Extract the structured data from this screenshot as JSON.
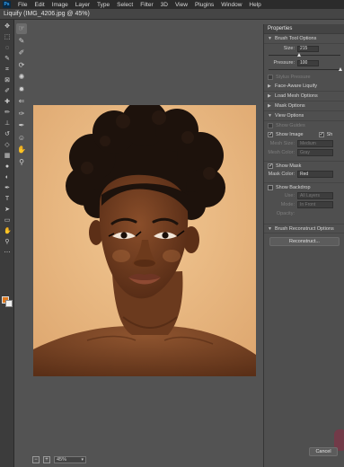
{
  "app": {
    "logo": "Ps"
  },
  "menu": [
    "File",
    "Edit",
    "Image",
    "Layer",
    "Type",
    "Select",
    "Filter",
    "3D",
    "View",
    "Plugins",
    "Window",
    "Help"
  ],
  "dialog": {
    "title": "Liquify (IMG_4206.jpg @ 45%)"
  },
  "canvas": {
    "zoom": "45%"
  },
  "colors": {
    "foreground": "#e07a1f",
    "background": "#f1f1f1",
    "canvas_background": "#e8b57f"
  },
  "liquify_tools": [
    "forward-warp-icon",
    "reconstruct-icon",
    "smooth-icon",
    "twirl-icon",
    "pucker-icon",
    "bloat-icon",
    "push-left-icon",
    "freeze-mask-icon",
    "thaw-mask-icon",
    "face-tool-icon",
    "hand-icon",
    "zoom-icon"
  ],
  "properties": {
    "title": "Properties",
    "brush_tool_options": {
      "header": "Brush Tool Options",
      "size_label": "Size:",
      "size_value": "215",
      "size_level": 0.43,
      "pressure_label": "Pressure:",
      "pressure_value": "100",
      "pressure_level": 1.0,
      "stylus_pressure": "Stylus Pressure"
    },
    "face_aware": "Face-Aware Liquify",
    "load_mesh": "Load Mesh Options",
    "mask_options": "Mask Options",
    "view_options": {
      "header": "View Options",
      "show_guides": "Show Guides",
      "show_image": "Show Image",
      "show_face_overlay": "Sh",
      "mesh_size_label": "Mesh Size:",
      "mesh_size_value": "Medium",
      "mesh_color_label": "Mesh Color:",
      "mesh_color_value": "Gray"
    },
    "show_mask": "Show Mask",
    "mask_color_label": "Mask Color:",
    "mask_color_value": "Red",
    "show_backdrop": "Show Backdrop",
    "backdrop": {
      "use_label": "Use:",
      "use_value": "All Layers",
      "mode_label": "Mode:",
      "mode_value": "In Front",
      "opacity_label": "Opacity:"
    },
    "reconstruct_options": "Brush Reconstruct Options",
    "reconstruct_button": "Reconstruct...",
    "cancel_button": "Cancel"
  }
}
